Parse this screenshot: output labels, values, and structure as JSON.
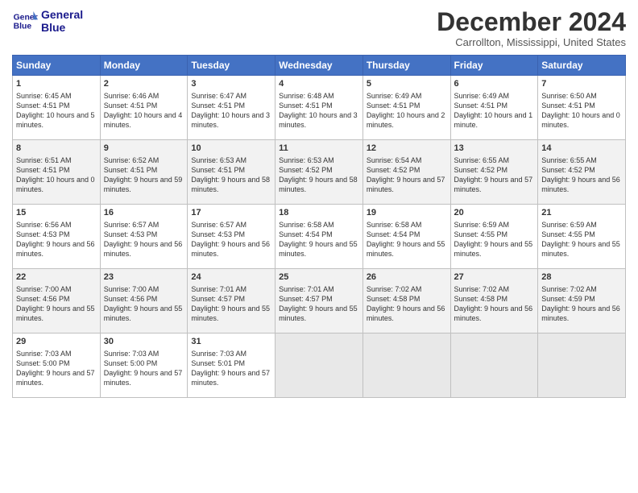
{
  "logo": {
    "line1": "General",
    "line2": "Blue"
  },
  "title": "December 2024",
  "location": "Carrollton, Mississippi, United States",
  "days_header": [
    "Sunday",
    "Monday",
    "Tuesday",
    "Wednesday",
    "Thursday",
    "Friday",
    "Saturday"
  ],
  "weeks": [
    [
      {
        "num": "1",
        "rise": "6:45 AM",
        "set": "4:51 PM",
        "daylight": "10 hours and 5 minutes."
      },
      {
        "num": "2",
        "rise": "6:46 AM",
        "set": "4:51 PM",
        "daylight": "10 hours and 4 minutes."
      },
      {
        "num": "3",
        "rise": "6:47 AM",
        "set": "4:51 PM",
        "daylight": "10 hours and 3 minutes."
      },
      {
        "num": "4",
        "rise": "6:48 AM",
        "set": "4:51 PM",
        "daylight": "10 hours and 3 minutes."
      },
      {
        "num": "5",
        "rise": "6:49 AM",
        "set": "4:51 PM",
        "daylight": "10 hours and 2 minutes."
      },
      {
        "num": "6",
        "rise": "6:49 AM",
        "set": "4:51 PM",
        "daylight": "10 hours and 1 minute."
      },
      {
        "num": "7",
        "rise": "6:50 AM",
        "set": "4:51 PM",
        "daylight": "10 hours and 0 minutes."
      }
    ],
    [
      {
        "num": "8",
        "rise": "6:51 AM",
        "set": "4:51 PM",
        "daylight": "10 hours and 0 minutes."
      },
      {
        "num": "9",
        "rise": "6:52 AM",
        "set": "4:51 PM",
        "daylight": "9 hours and 59 minutes."
      },
      {
        "num": "10",
        "rise": "6:53 AM",
        "set": "4:51 PM",
        "daylight": "9 hours and 58 minutes."
      },
      {
        "num": "11",
        "rise": "6:53 AM",
        "set": "4:52 PM",
        "daylight": "9 hours and 58 minutes."
      },
      {
        "num": "12",
        "rise": "6:54 AM",
        "set": "4:52 PM",
        "daylight": "9 hours and 57 minutes."
      },
      {
        "num": "13",
        "rise": "6:55 AM",
        "set": "4:52 PM",
        "daylight": "9 hours and 57 minutes."
      },
      {
        "num": "14",
        "rise": "6:55 AM",
        "set": "4:52 PM",
        "daylight": "9 hours and 56 minutes."
      }
    ],
    [
      {
        "num": "15",
        "rise": "6:56 AM",
        "set": "4:53 PM",
        "daylight": "9 hours and 56 minutes."
      },
      {
        "num": "16",
        "rise": "6:57 AM",
        "set": "4:53 PM",
        "daylight": "9 hours and 56 minutes."
      },
      {
        "num": "17",
        "rise": "6:57 AM",
        "set": "4:53 PM",
        "daylight": "9 hours and 56 minutes."
      },
      {
        "num": "18",
        "rise": "6:58 AM",
        "set": "4:54 PM",
        "daylight": "9 hours and 55 minutes."
      },
      {
        "num": "19",
        "rise": "6:58 AM",
        "set": "4:54 PM",
        "daylight": "9 hours and 55 minutes."
      },
      {
        "num": "20",
        "rise": "6:59 AM",
        "set": "4:55 PM",
        "daylight": "9 hours and 55 minutes."
      },
      {
        "num": "21",
        "rise": "6:59 AM",
        "set": "4:55 PM",
        "daylight": "9 hours and 55 minutes."
      }
    ],
    [
      {
        "num": "22",
        "rise": "7:00 AM",
        "set": "4:56 PM",
        "daylight": "9 hours and 55 minutes."
      },
      {
        "num": "23",
        "rise": "7:00 AM",
        "set": "4:56 PM",
        "daylight": "9 hours and 55 minutes."
      },
      {
        "num": "24",
        "rise": "7:01 AM",
        "set": "4:57 PM",
        "daylight": "9 hours and 55 minutes."
      },
      {
        "num": "25",
        "rise": "7:01 AM",
        "set": "4:57 PM",
        "daylight": "9 hours and 55 minutes."
      },
      {
        "num": "26",
        "rise": "7:02 AM",
        "set": "4:58 PM",
        "daylight": "9 hours and 56 minutes."
      },
      {
        "num": "27",
        "rise": "7:02 AM",
        "set": "4:58 PM",
        "daylight": "9 hours and 56 minutes."
      },
      {
        "num": "28",
        "rise": "7:02 AM",
        "set": "4:59 PM",
        "daylight": "9 hours and 56 minutes."
      }
    ],
    [
      {
        "num": "29",
        "rise": "7:03 AM",
        "set": "5:00 PM",
        "daylight": "9 hours and 57 minutes."
      },
      {
        "num": "30",
        "rise": "7:03 AM",
        "set": "5:00 PM",
        "daylight": "9 hours and 57 minutes."
      },
      {
        "num": "31",
        "rise": "7:03 AM",
        "set": "5:01 PM",
        "daylight": "9 hours and 57 minutes."
      },
      null,
      null,
      null,
      null
    ]
  ],
  "labels": {
    "sunrise": "Sunrise:",
    "sunset": "Sunset:",
    "daylight": "Daylight:"
  }
}
